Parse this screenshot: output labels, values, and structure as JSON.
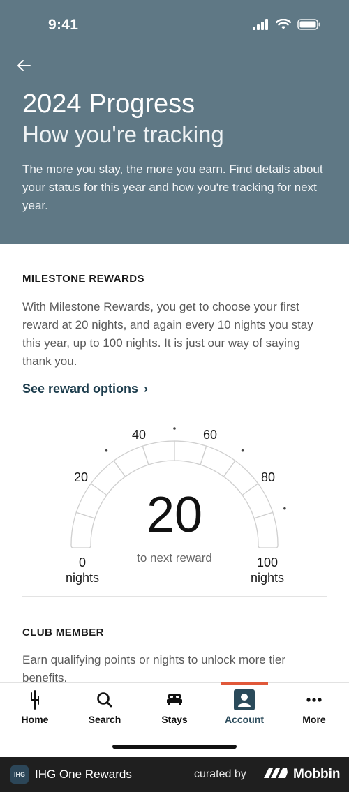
{
  "status": {
    "time": "9:41"
  },
  "header": {
    "title": "2024 Progress",
    "subtitle": "How you're tracking",
    "description": "The more you stay, the more you earn. Find details about your status for this year and how you're tracking for next year."
  },
  "milestone": {
    "heading": "MILESTONE REWARDS",
    "text": "With Milestone Rewards, you get to choose your first reward at 20 nights, and again every 10 nights you stay this year, up to 100 nights. It is just our way of saying thank you.",
    "link_label": "See reward options",
    "link_chevron": "›"
  },
  "gauge": {
    "center_value": "20",
    "center_caption": "to next reward",
    "labels": {
      "l20": "20",
      "l40": "40",
      "l60": "60",
      "l80": "80"
    },
    "start_value": "0",
    "start_unit": "nights",
    "end_value": "100",
    "end_unit": "nights",
    "min": 0,
    "max": 100,
    "segments": 10,
    "progress": 0
  },
  "club": {
    "heading": "CLUB MEMBER",
    "text": "Earn qualifying points or nights to unlock more tier benefits."
  },
  "tabs": [
    {
      "label": "Home",
      "icon": "ihg-logo-icon"
    },
    {
      "label": "Search",
      "icon": "search-icon"
    },
    {
      "label": "Stays",
      "icon": "bed-icon"
    },
    {
      "label": "Account",
      "icon": "account-icon",
      "active": true
    },
    {
      "label": "More",
      "icon": "more-dots-icon"
    }
  ],
  "footer": {
    "logo_text": "IHG",
    "app_name": "IHG One Rewards",
    "curated": "curated by",
    "brand": "Mobbin"
  },
  "colors": {
    "header_bg": "#5f7885",
    "link": "#1d3d4d",
    "tab_active_indicator": "#e0583a",
    "account_icon_bg": "#2a4a5a"
  }
}
